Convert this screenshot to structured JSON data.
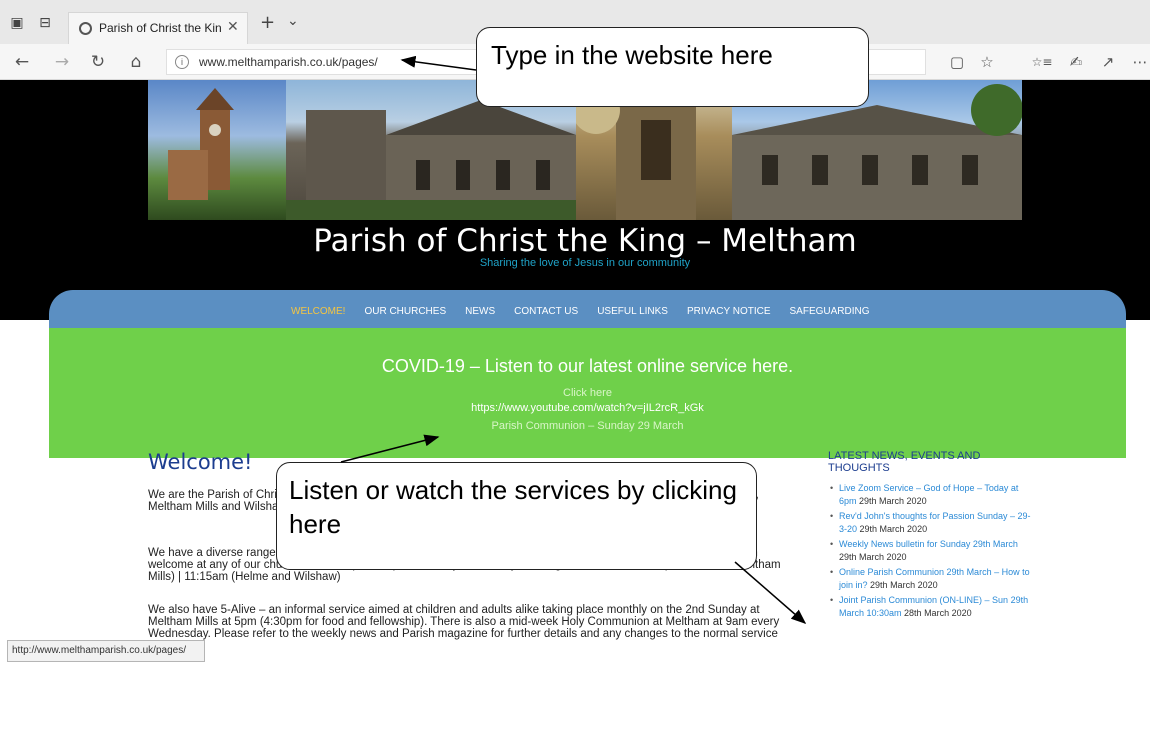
{
  "browser": {
    "tab_title": "Parish of Christ the Kinç",
    "url": "www.melthamparish.co.uk/pages/",
    "icons": {
      "tab_actions": "tab-actions-icon",
      "set_aside": "set-aside-tabs-icon",
      "favicon": "page-loading-icon",
      "close": "✕",
      "new_tab": "+",
      "tab_list": "⌄",
      "back": "←",
      "forward": "→",
      "refresh": "↻",
      "home": "⌂",
      "info": "i",
      "reading": "▢",
      "favorite": "☆",
      "favorites_bar": "☆≡",
      "notes": "✍",
      "share": "↗",
      "more": "⋯"
    }
  },
  "site": {
    "title": "Parish of Christ the King – Meltham",
    "tagline": "Sharing the love of Jesus in our community",
    "nav": [
      {
        "label": "WELCOME!",
        "active": true
      },
      {
        "label": "OUR CHURCHES"
      },
      {
        "label": "NEWS"
      },
      {
        "label": "CONTACT US"
      },
      {
        "label": "USEFUL LINKS"
      },
      {
        "label": "PRIVACY NOTICE"
      },
      {
        "label": "SAFEGUARDING"
      }
    ],
    "covid": {
      "heading": "COVID-19 – Listen to our latest online service here.",
      "click": "Click here",
      "url": "https://www.youtube.com/watch?v=jIL2rcR_kGk",
      "subtitle": "Parish Communion – Sunday 29 March"
    },
    "welcome": {
      "heading": "Welcome!",
      "p1": "We are the Parish of Christ the King  – four churches serving the village of Meltham and the surrounding areas of Helme, Meltham Mills and Wilshaw.  Here you will find all the latest info about what is going on in and around the Parish.",
      "p2": "We have a diverse range of services across the Parish with worship styles and times to suit everyone.  You'll find a warm welcome at any of our churches.  Worship takes place weekly on Sunday morning as follows: 9:30am (Meltham and Meltham Mills)  |  11:15am (Helme and Wilshaw)",
      "p3": "We also have 5-Alive – an informal service aimed at children and adults alike taking place monthly on the 2nd Sunday at Meltham Mills at 5pm (4:30pm for food and fellowship).  There is also a mid-week Holy Communion at Meltham at 9am every Wednesday.  Please refer to the weekly news and Parish magazine for further details and any changes to the normal service patterns."
    },
    "news": {
      "heading": "LATEST NEWS, EVENTS AND THOUGHTS",
      "items": [
        {
          "link": "Live Zoom Service – God of Hope – Today at 6pm",
          "date": "29th March 2020"
        },
        {
          "link": "Rev'd John's thoughts for Passion Sunday – 29-3-20",
          "date": "29th March 2020"
        },
        {
          "link": "Weekly News bulletin for Sunday 29th March",
          "date": "29th March 2020"
        },
        {
          "link": "Online Parish Communion 29th March – How to join in?",
          "date": "29th March 2020"
        },
        {
          "link": "Joint Parish Communion (ON-LINE) – Sun 29th March 10:30am",
          "date": "28th March 2020"
        }
      ]
    },
    "status_url": "http://www.melthamparish.co.uk/pages/"
  },
  "annotations": {
    "callout1": "Type in the website here",
    "callout2": "Listen or watch the services by clicking here"
  }
}
